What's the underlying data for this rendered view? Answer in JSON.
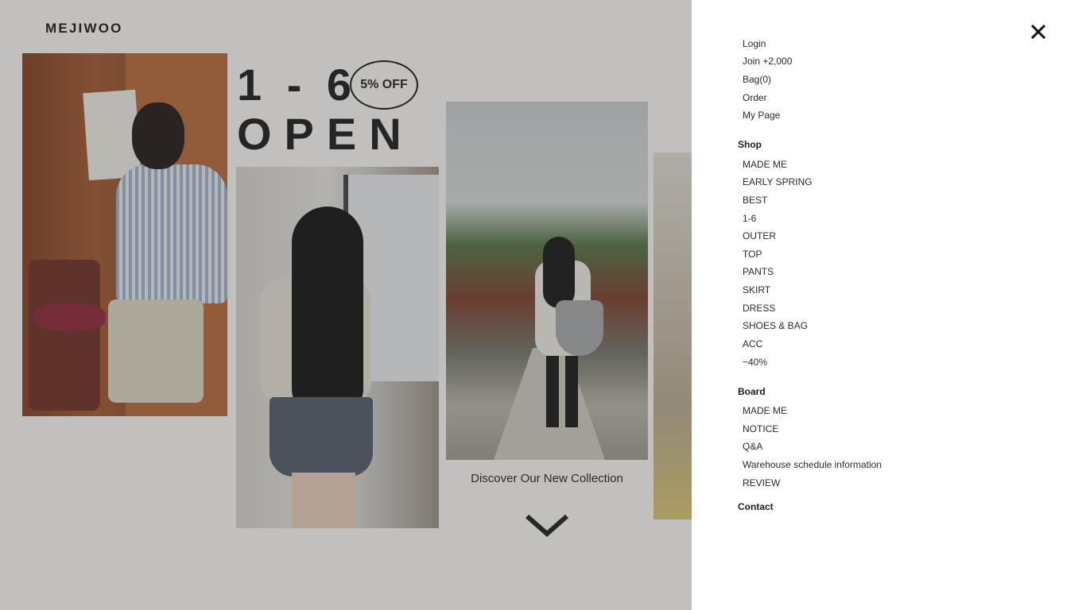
{
  "brand": {
    "logo": "MEJIWOO"
  },
  "hero": {
    "dates": "1 - 6",
    "open": "OPEN",
    "badge": "5% OFF",
    "collection_text": "Discover Our New Collection"
  },
  "menu": {
    "account": [
      "Login",
      "Join +2,000",
      "Bag(0)",
      "Order",
      "My Page"
    ],
    "shop_heading": "Shop",
    "shop": [
      "MADE ME",
      "EARLY SPRING",
      "BEST",
      "1-6",
      "OUTER",
      "TOP",
      "PANTS",
      "SKIRT",
      "DRESS",
      "SHOES & BAG",
      "ACC",
      "~40%"
    ],
    "board_heading": "Board",
    "board": [
      "MADE ME",
      "NOTICE",
      "Q&A",
      "Warehouse schedule information",
      "REVIEW"
    ],
    "contact_heading": "Contact"
  },
  "icons": {
    "close": "close-icon",
    "scroll": "chevron-down-icon"
  },
  "colors": {
    "overlay": "#464646",
    "menu_bg": "#ffffff",
    "text": "#2c2c2c"
  }
}
